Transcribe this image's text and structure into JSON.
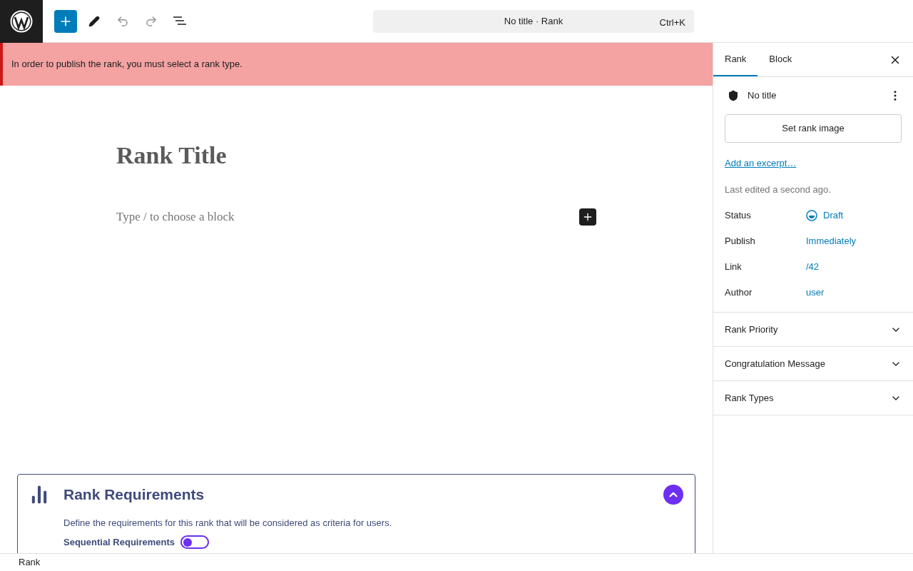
{
  "toolbar": {
    "document_title": "No title · Rank",
    "shortcut": "Ctrl+K"
  },
  "notice": {
    "message": "In order to publish the rank, you must select a rank type."
  },
  "editor": {
    "title": "Rank Title",
    "block_placeholder": "Type / to choose a block"
  },
  "requirements": {
    "title": "Rank Requirements",
    "expanded": true,
    "description": "Define the requirements for this rank that will be considered as criteria for users.",
    "sequential": {
      "label": "Sequential Requirements",
      "on": false
    }
  },
  "sidebar": {
    "tabs": [
      {
        "label": "Rank",
        "selected": true
      },
      {
        "label": "Block",
        "selected": false
      }
    ],
    "post_title": "No title",
    "image_button": "Set rank image",
    "excerpt_link": "Add an excerpt…",
    "last_edited": "Last edited a second ago.",
    "fields": [
      {
        "label": "Status",
        "value": "Draft",
        "kind": "status"
      },
      {
        "label": "Publish",
        "value": "Immediately",
        "kind": "link"
      },
      {
        "label": "Link",
        "value": "/42",
        "kind": "link"
      },
      {
        "label": "Author",
        "value": "user",
        "kind": "link"
      }
    ],
    "panels": [
      {
        "title": "Rank Priority",
        "expanded": false
      },
      {
        "title": "Congratulation Message",
        "expanded": false
      },
      {
        "title": "Rank Types",
        "expanded": false
      }
    ]
  },
  "footer": {
    "breadcrumb": "Rank"
  }
}
